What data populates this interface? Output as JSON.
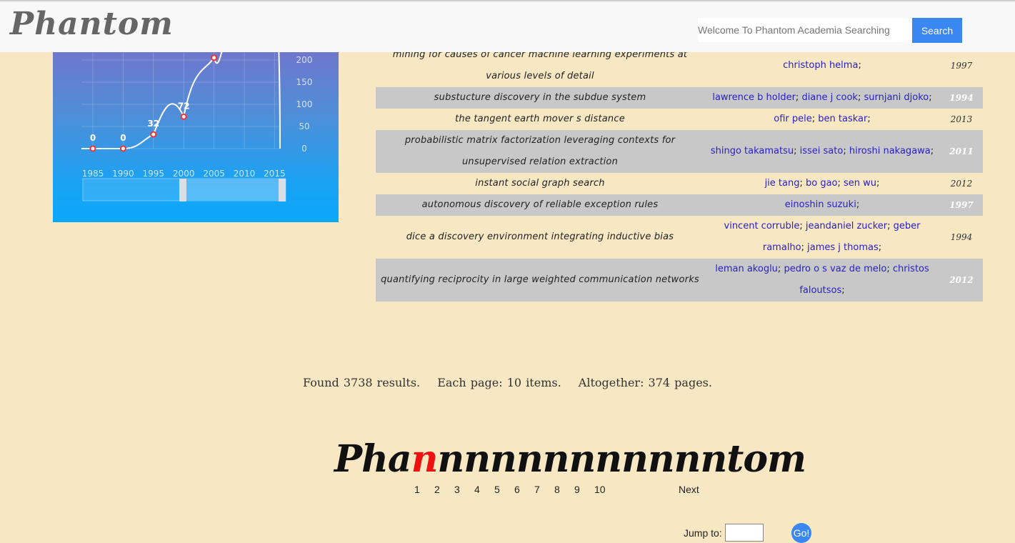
{
  "header": {
    "logo": "Phantom",
    "search_placeholder": "Welcome To Phantom Academia Searching",
    "search_label": "Search"
  },
  "chart_data": {
    "type": "line",
    "x": [
      1985,
      1990,
      1995,
      2000,
      2005
    ],
    "y": [
      0,
      0,
      32,
      72,
      205
    ],
    "point_labels": [
      "0",
      "0",
      "32",
      "72"
    ],
    "xticks": [
      "1985",
      "1990",
      "1995",
      "2000",
      "2005",
      "2010",
      "2015"
    ],
    "yticks": [
      "0",
      "50",
      "100",
      "150",
      "200"
    ],
    "grid": true
  },
  "results": [
    {
      "title": "mining for causes of cancer machine learning experiments at various levels of detail",
      "authors": [
        "christoph helma"
      ],
      "year": "1997",
      "gray": false
    },
    {
      "title": "substucture discovery in the subdue system",
      "authors": [
        "lawrence b holder",
        "diane j cook",
        "surnjani djoko"
      ],
      "year": "1994",
      "gray": true
    },
    {
      "title": "the tangent earth mover s distance",
      "authors": [
        "ofir pele",
        "ben taskar"
      ],
      "year": "2013",
      "gray": false
    },
    {
      "title": "probabilistic matrix factorization leveraging contexts for unsupervised relation extraction",
      "authors": [
        "shingo takamatsu",
        "issei sato",
        "hiroshi nakagawa"
      ],
      "year": "2011",
      "gray": true
    },
    {
      "title": "instant social graph search",
      "authors": [
        "jie tang",
        "bo gao",
        "sen wu"
      ],
      "year": "2012",
      "gray": false
    },
    {
      "title": "autonomous discovery of reliable exception rules",
      "authors": [
        "einoshin suzuki"
      ],
      "year": "1997",
      "gray": true
    },
    {
      "title": "dice a discovery environment integrating inductive bias",
      "authors": [
        "vincent corruble",
        "jeandaniel zucker",
        "geber ramalho",
        "james j thomas"
      ],
      "year": "1994",
      "gray": false
    },
    {
      "title": "quantifying reciprocity in large weighted communication networks",
      "authors": [
        "leman akoglu",
        "pedro o s vaz de melo",
        "christos faloutsos"
      ],
      "year": "2012",
      "gray": true
    }
  ],
  "summary": {
    "found": "Found 3738 results.",
    "per_page": "Each page: 10 items.",
    "total": "Altogether: 374 pages."
  },
  "pager": {
    "logo_start": "Pha",
    "logo_red": "n",
    "logo_mid": "nnnnnnnnnnn",
    "logo_end": "tom",
    "pages": [
      "1",
      "2",
      "3",
      "4",
      "5",
      "6",
      "7",
      "8",
      "9",
      "10"
    ],
    "next": "Next",
    "jump_label": "Jump to:",
    "go": "Go!"
  }
}
